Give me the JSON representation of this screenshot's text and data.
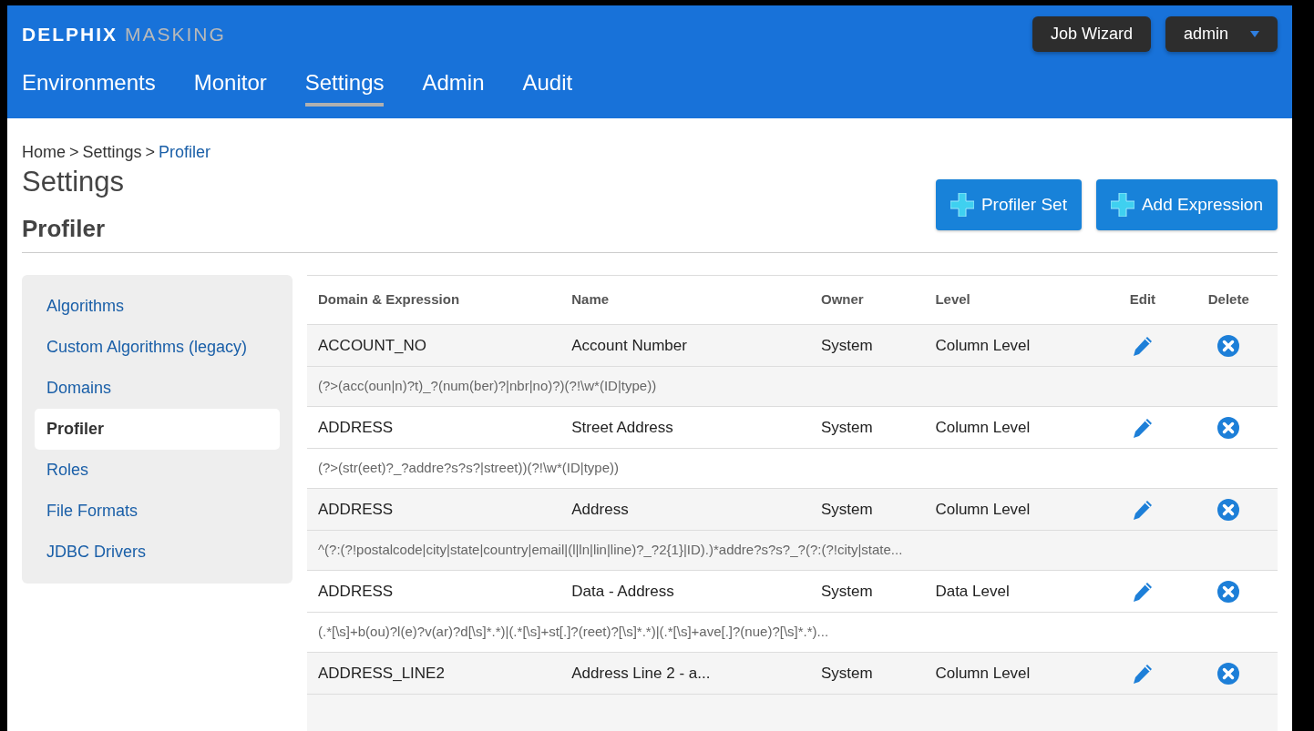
{
  "brand": {
    "bold": "DELPHIX",
    "light": "MASKING"
  },
  "header_buttons": {
    "wizard": "Job Wizard",
    "user": "admin"
  },
  "nav": [
    {
      "label": "Environments",
      "selected": false
    },
    {
      "label": "Monitor",
      "selected": false
    },
    {
      "label": "Settings",
      "selected": true
    },
    {
      "label": "Admin",
      "selected": false
    },
    {
      "label": "Audit",
      "selected": false
    }
  ],
  "breadcrumb": [
    {
      "label": "Home",
      "current": false
    },
    {
      "label": "Settings",
      "current": false
    },
    {
      "label": "Profiler",
      "current": true
    }
  ],
  "breadcrumb_separator": ">",
  "page_title": "Settings",
  "section_title": "Profiler",
  "actions": [
    "Profiler Set",
    "Add Expression"
  ],
  "sidebar": [
    {
      "label": "Algorithms",
      "selected": false
    },
    {
      "label": "Custom Algorithms (legacy)",
      "selected": false
    },
    {
      "label": "Domains",
      "selected": false
    },
    {
      "label": "Profiler",
      "selected": true
    },
    {
      "label": "Roles",
      "selected": false
    },
    {
      "label": "File Formats",
      "selected": false
    },
    {
      "label": "JDBC Drivers",
      "selected": false
    }
  ],
  "table": {
    "columns": [
      "Domain & Expression",
      "Name",
      "Owner",
      "Level",
      "Edit",
      "Delete"
    ],
    "rows": [
      {
        "domain": "ACCOUNT_NO",
        "name": "Account Number",
        "owner": "System",
        "level_text": "Column Level",
        "expression": "(?>(acc(oun|n)?t)_?(num(ber)?|nbr|no)?)(?!\\w*(ID|type))"
      },
      {
        "domain": "ADDRESS",
        "name": "Street Address",
        "owner": "System",
        "level_text": "Column Level",
        "expression": "(?>(str(eet)?_?addre?s?s?|street))(?!\\w*(ID|type))"
      },
      {
        "domain": "ADDRESS",
        "name": "Address",
        "owner": "System",
        "level_text": "Column Level",
        "expression": "^(?:(?!postalcode|city|state|country|email|(l|ln|lin|line)?_?2{1}|ID).)*addre?s?s?_?(?:(?!city|state..."
      },
      {
        "domain": "ADDRESS",
        "name": "Data - Address",
        "owner": "System",
        "level_text": "Data Level",
        "expression": "(.*[\\s]+b(ou)?l(e)?v(ar)?d[\\s]*.*)|(.*[\\s]+st[.]?(reet)?[\\s]*.*)|(.*[\\s]+ave[.]?(nue)?[\\s]*.*)..."
      },
      {
        "domain": "ADDRESS_LINE2",
        "name": "Address Line 2 - a...",
        "owner": "System",
        "level_text": "Column Level"
      }
    ]
  }
}
